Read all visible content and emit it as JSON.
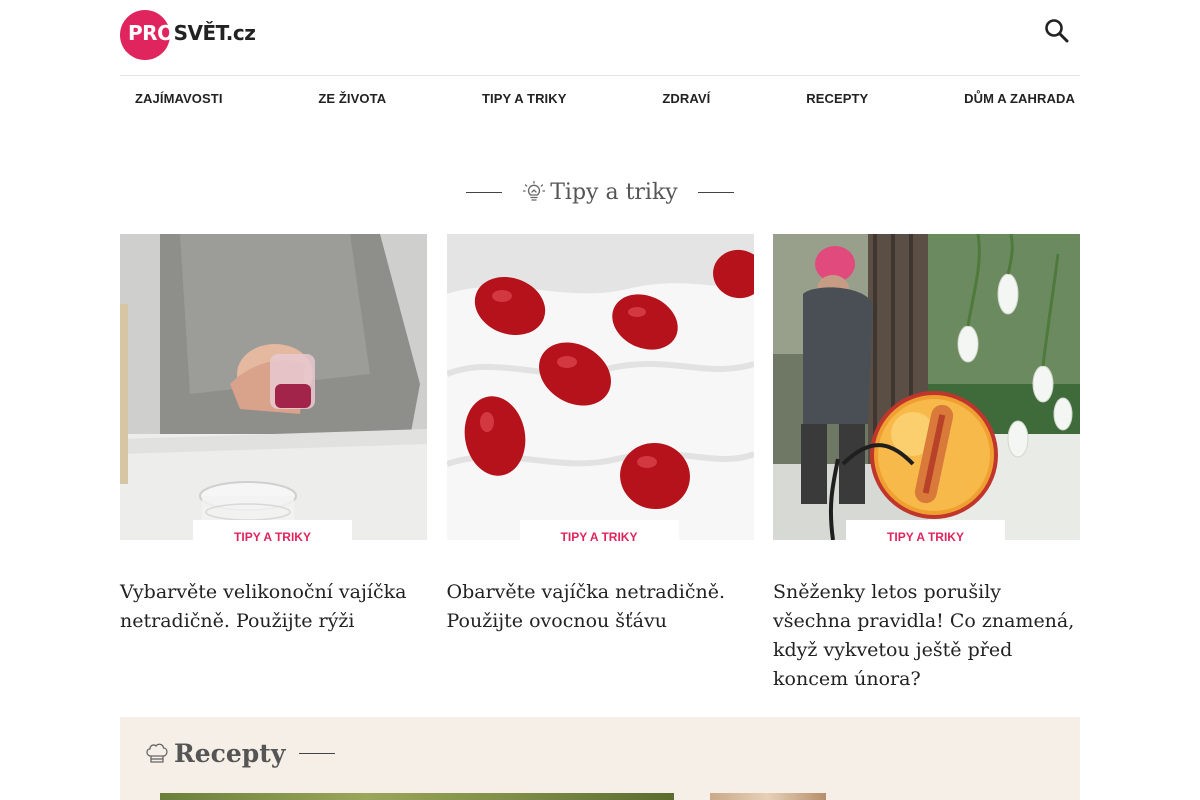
{
  "header": {
    "logo_pro": "PR",
    "logo_o": "O",
    "logo_svet": "SVĚT",
    "logo_cz": ".cz",
    "brand_color": "#e0245e",
    "search_icon": "search-icon"
  },
  "nav": {
    "items": [
      {
        "label": "ZAJÍMAVOSTI"
      },
      {
        "label": "ZE ŽIVOTA"
      },
      {
        "label": "TIPY A TRIKY"
      },
      {
        "label": "ZDRAVÍ"
      },
      {
        "label": "RECEPTY"
      },
      {
        "label": "DŮM A ZAHRADA"
      }
    ]
  },
  "tips_section": {
    "title": "Tipy a triky",
    "icon": "lightbulb-icon",
    "cards": [
      {
        "tag": "TIPY A TRIKY",
        "title": "Vybarvěte velikonoční vajíčka netradičně. Použijte rýži"
      },
      {
        "tag": "TIPY A TRIKY",
        "title": "Obarvěte vajíčka netradičně. Použijte ovocnou šťávu"
      },
      {
        "tag": "TIPY A TRIKY",
        "title": "Sněženky letos porušily všechna pravidla! Co znamená, když vykvetou ještě před koncem února?"
      }
    ]
  },
  "recipes_section": {
    "title": "Recepty",
    "icon": "chef-hat-icon"
  }
}
